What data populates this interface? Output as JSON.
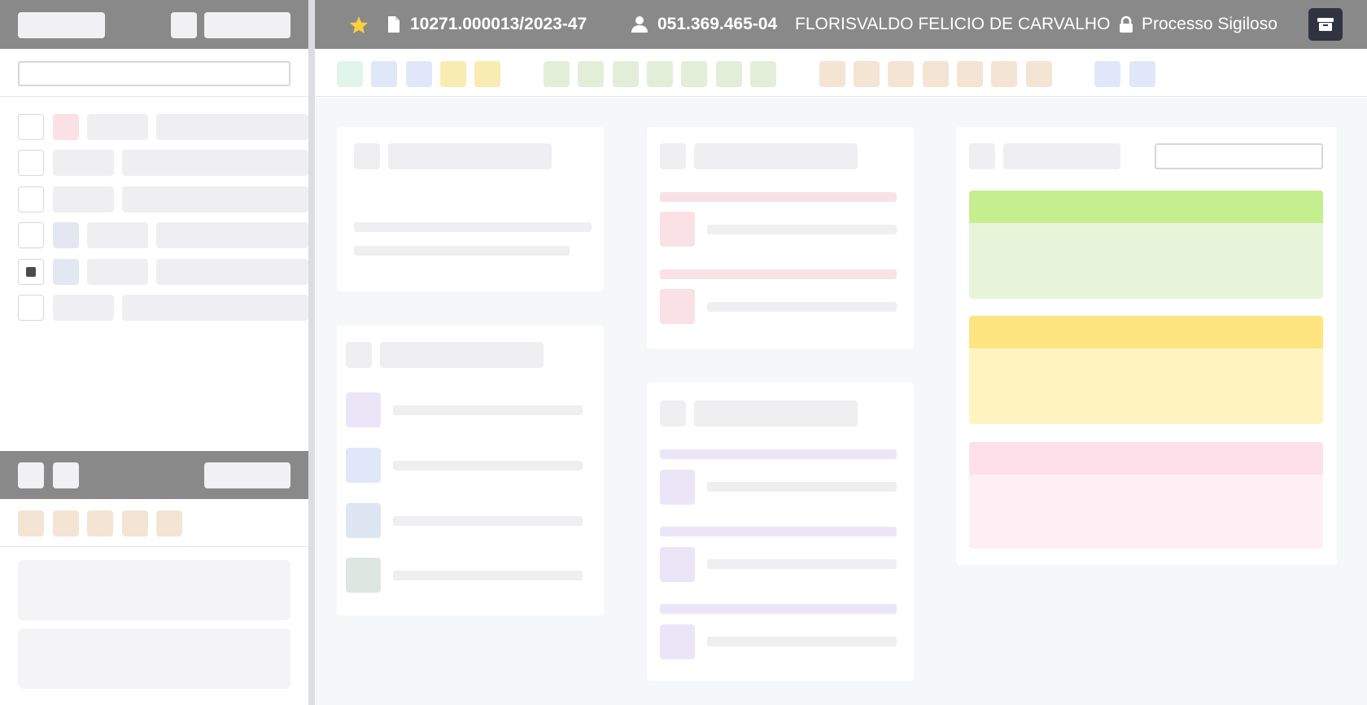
{
  "header": {
    "star_icon": "star-icon",
    "process_number": "10271.000013/2023-47",
    "cpf": "051.369.465-04",
    "name": "FLORISVALDO FELICIO DE CARVALHO",
    "secrecy": "Processo Sigiloso",
    "archive_icon": "archive-icon"
  },
  "search": {
    "value": ""
  },
  "colors": {
    "header_bg": "#898989",
    "accent_green": "#c5ef8e",
    "accent_yellow": "#ffe57f",
    "accent_pink": "#fde0ea",
    "archive_button": "#2f3440"
  },
  "list": {
    "selected_index": 4
  }
}
